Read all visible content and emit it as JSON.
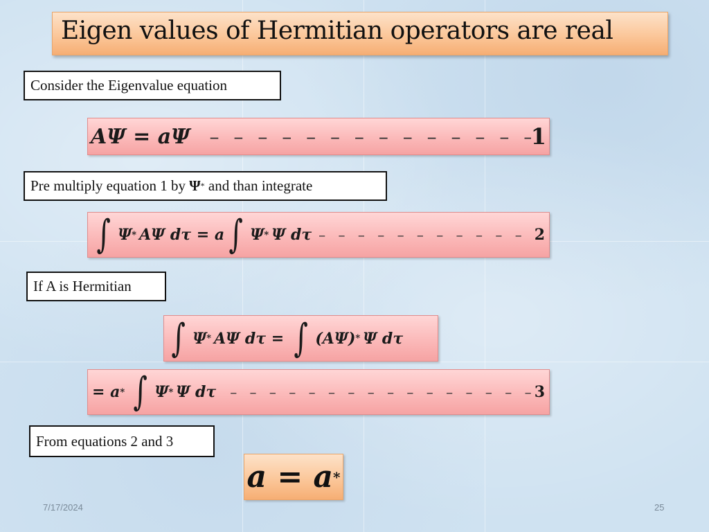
{
  "slide": {
    "title": "Eigen values of Hermitian operators are real",
    "date": "7/17/2024",
    "page_number": "25"
  },
  "labels": {
    "consider": "Consider the Eigenvalue equation",
    "premultiply_prefix": "Pre multiply equation 1 by ",
    "premultiply_psi": "Ψ",
    "premultiply_star": "*",
    "premultiply_suffix": " and than integrate",
    "hermitian": "If A is Hermitian",
    "from_eq": "From equations 2 and 3"
  },
  "equations": {
    "eq1": {
      "lhs": "AΨ = aΨ",
      "dashes": "– – – – – – – – – – – – – – –",
      "number": "1"
    },
    "eq2": {
      "int1": "∫",
      "part1": "Ψ",
      "star1": "*",
      "part2": "AΨ dτ = a",
      "int2": "∫",
      "part3": "Ψ",
      "star2": "*",
      "part4": "Ψ dτ",
      "dashes": "– – – – – – – – – – – –",
      "number": "2"
    },
    "herm": {
      "int1": "∫",
      "part1": "Ψ",
      "star1": "*",
      "part2": "AΨ dτ =",
      "int2": "∫",
      "part3": "(AΨ)",
      "star2": "*",
      "part4": "Ψ dτ"
    },
    "eq3": {
      "prefix": "= a",
      "star1": "*",
      "int1": "∫",
      "part1": "Ψ",
      "star2": "*",
      "part2": "Ψ dτ",
      "dashes": "– – – – – – – – – – – – – – – – – – –",
      "number": "3"
    },
    "result": {
      "lhs": "a = a",
      "star": "*"
    }
  }
}
